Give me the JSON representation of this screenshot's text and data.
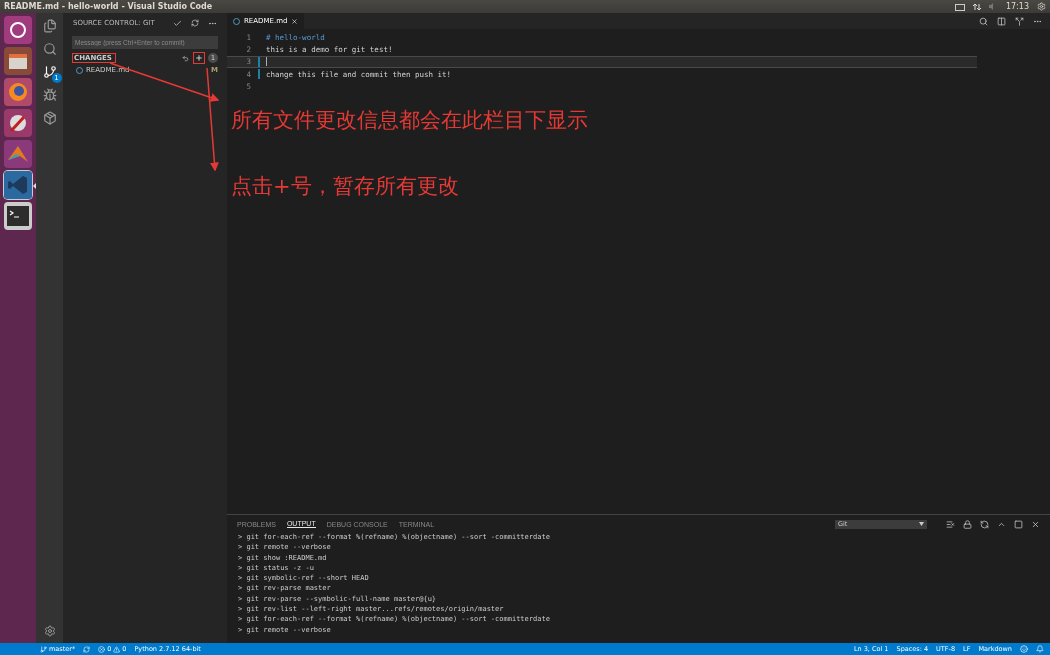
{
  "window": {
    "title": "README.md - hello-world - Visual Studio Code",
    "clock": "17:13"
  },
  "launcher": [
    {
      "kind": "ubuntu",
      "selected": false
    },
    {
      "kind": "files",
      "selected": false
    },
    {
      "kind": "firefox",
      "selected": false
    },
    {
      "kind": "settings",
      "selected": false
    },
    {
      "kind": "matlab",
      "selected": false
    },
    {
      "kind": "vscode",
      "selected": true
    },
    {
      "kind": "terminal",
      "selected": false
    }
  ],
  "activity_bar": [
    {
      "kind": "explorer",
      "selected": false
    },
    {
      "kind": "search",
      "selected": false
    },
    {
      "kind": "git",
      "selected": true,
      "badge": "1"
    },
    {
      "kind": "debug",
      "selected": false
    },
    {
      "kind": "extensions",
      "selected": false
    }
  ],
  "sidebar": {
    "title": "SOURCE CONTROL: GIT",
    "message": {
      "placeholder": "Message (press Ctrl+Enter to commit)"
    },
    "section": "CHANGES",
    "count": "1",
    "files": [
      {
        "name": "README.md",
        "status": "M"
      }
    ]
  },
  "editor": {
    "tab": "README.md",
    "lines": [
      {
        "number": "1",
        "text": "# hello-world",
        "kind": "heading",
        "current": false
      },
      {
        "number": "2",
        "text": "this is a demo for git test!",
        "kind": "text",
        "current": false
      },
      {
        "number": "3",
        "current": true
      },
      {
        "number": "4",
        "text": "change this file and commit then push it!",
        "kind": "text",
        "current": false
      },
      {
        "number": "5",
        "current": false
      }
    ]
  },
  "panel": {
    "tabs": [
      {
        "label": "PROBLEMS",
        "selected": false
      },
      {
        "label": "OUTPUT",
        "selected": true
      },
      {
        "label": "DEBUG CONSOLE",
        "selected": false
      },
      {
        "label": "TERMINAL",
        "selected": false
      }
    ],
    "channel": "Git",
    "output": [
      "> git for-each-ref --format %(refname) %(objectname) --sort -committerdate",
      "> git remote --verbose",
      "> git show :README.md",
      "> git status -z -u",
      "> git symbolic-ref --short HEAD",
      "> git rev-parse master",
      "> git rev-parse --symbolic-full-name master@{u}",
      "> git rev-list --left-right master...refs/remotes/origin/master",
      "> git for-each-ref --format %(refname) %(objectname) --sort -committerdate",
      "> git remote --verbose"
    ]
  },
  "status_bar": {
    "branch": "master*",
    "errors": "0",
    "warnings": "0",
    "interpreter": "Python 2.7.12 64-bit",
    "right": [
      "Ln 3, Col 1",
      "Spaces: 4",
      "UTF-8",
      "LF",
      "Markdown"
    ]
  },
  "annotations": [
    "所有文件更改信息都会在此栏目下显示",
    "点击+号，暂存所有更改"
  ]
}
